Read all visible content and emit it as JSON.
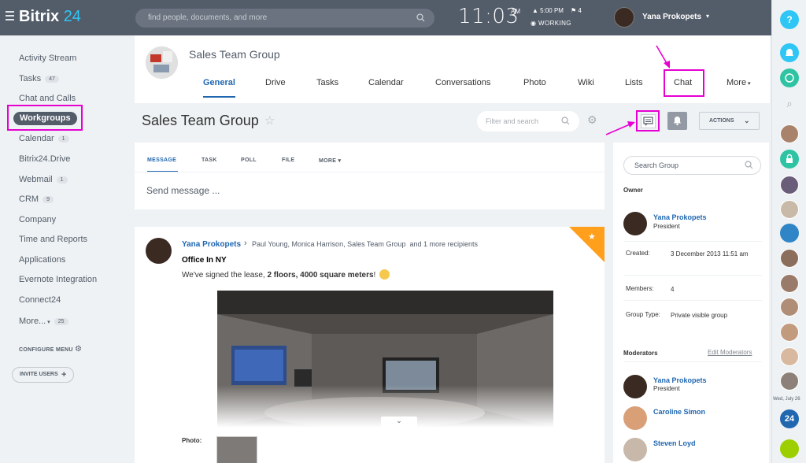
{
  "topbar": {
    "logo_main": "Bitrix",
    "logo_num": "24",
    "search_placeholder": "find people, documents, and more",
    "clock_time": "11:03",
    "clock_ampm": "AM",
    "tasks_time": "5:00 PM",
    "tasks_flag": "4",
    "work_status": "WORKING",
    "user_name": "Yana Prokopets"
  },
  "sidebar": {
    "items": [
      {
        "label": "Activity Stream",
        "count": ""
      },
      {
        "label": "Tasks",
        "count": "47"
      },
      {
        "label": "Chat and Calls",
        "count": ""
      },
      {
        "label": "Workgroups",
        "count": ""
      },
      {
        "label": "Calendar",
        "count": "1"
      },
      {
        "label": "Bitrix24.Drive",
        "count": ""
      },
      {
        "label": "Webmail",
        "count": "1"
      },
      {
        "label": "CRM",
        "count": "9"
      },
      {
        "label": "Company",
        "count": ""
      },
      {
        "label": "Time and Reports",
        "count": ""
      },
      {
        "label": "Applications",
        "count": ""
      },
      {
        "label": "Evernote Integration",
        "count": ""
      },
      {
        "label": "Connect24",
        "count": ""
      },
      {
        "label": "More...",
        "count": "25"
      }
    ],
    "configure_menu": "CONFIGURE MENU",
    "invite_users": "INVITE USERS"
  },
  "group": {
    "name": "Sales Team Group",
    "tabs": [
      "General",
      "Drive",
      "Tasks",
      "Calendar",
      "Conversations",
      "Photo",
      "Wiki",
      "Lists",
      "Chat",
      "More"
    ],
    "title": "Sales Team Group",
    "filter_placeholder": "Filter and search",
    "actions_label": "ACTIONS"
  },
  "composer": {
    "tabs": [
      "MESSAGE",
      "TASK",
      "POLL",
      "FILE",
      "MORE"
    ],
    "placeholder": "Send message ..."
  },
  "post": {
    "author": "Yana Prokopets",
    "recipients": "Paul Young, Monica Harrison, Sales Team Group",
    "more_recipients": "and 1 more recipients",
    "title": "Office In NY",
    "body_start": "We've signed the lease, ",
    "body_bold": "2 floors, 4000 square meters",
    "body_end": "!",
    "photo_label": "Photo:"
  },
  "info_panel": {
    "search_placeholder": "Search Group",
    "owner_label": "Owner",
    "owner": {
      "name": "Yana Prokopets",
      "role": "President"
    },
    "created_key": "Created:",
    "created_val": "3 December 2013 11:51 am",
    "members_key": "Members:",
    "members_val": "4",
    "type_key": "Group Type:",
    "type_val": "Private visible group",
    "moderators_label": "Moderators",
    "edit_moderators": "Edit Moderators",
    "moderators": [
      {
        "name": "Yana Prokopets",
        "role": "President"
      },
      {
        "name": "Caroline Simon",
        "role": ""
      },
      {
        "name": "Steven Loyd",
        "role": ""
      }
    ]
  },
  "right_bar": {
    "date_label": "Wed, July 26",
    "help": "?",
    "badge": "24"
  },
  "colors": {
    "topbar": "#535c69",
    "link": "#2067b0",
    "highlight": "#e600d2",
    "accent": "#2fc6f6",
    "fav": "#ff9f1c"
  }
}
